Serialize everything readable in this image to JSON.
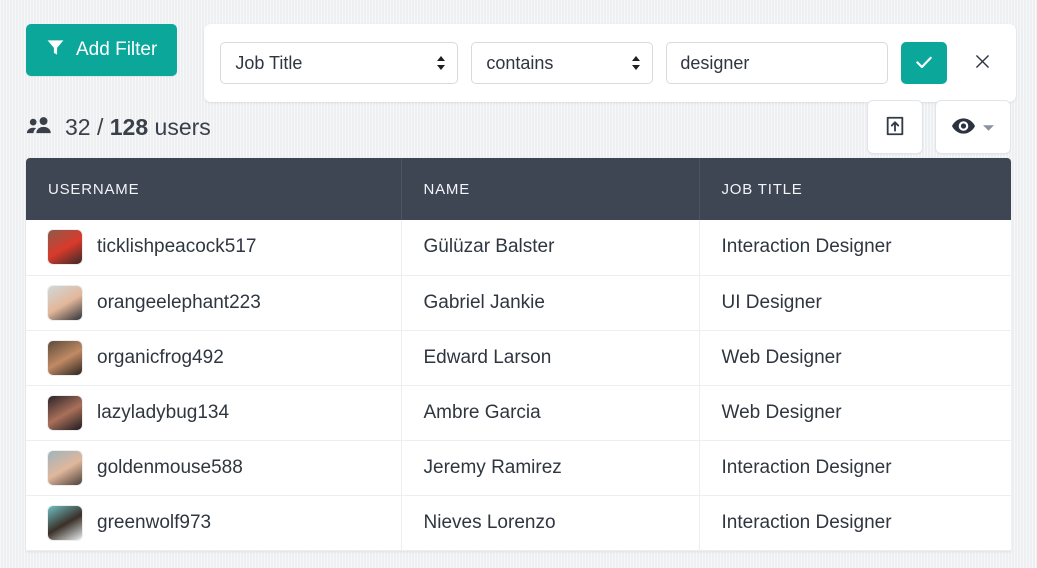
{
  "filter_bar": {
    "add_filter_label": "Add Filter",
    "add_filter_icon": "funnel-icon",
    "field_select_value": "Job Title",
    "operator_select_value": "contains",
    "value_input": "designer",
    "value_placeholder": "",
    "apply_icon": "check-icon",
    "remove_icon": "close-icon",
    "accent_color": "#0ba79b"
  },
  "summary": {
    "users_icon": "users-icon",
    "filtered_count": "32",
    "separator": "/",
    "total_count": "128",
    "unit_label": "users",
    "export_icon": "export-icon",
    "visibility_icon": "eye-icon",
    "visibility_caret_icon": "chevron-down-icon"
  },
  "table": {
    "columns": [
      "USERNAME",
      "NAME",
      "JOB TITLE"
    ],
    "header_bg": "#3e4654",
    "rows": [
      {
        "username": "ticklishpeacock517",
        "name": "Gülüzar Balster",
        "job_title": "Interaction Designer",
        "avatar_colors": [
          "#8d5a4a",
          "#d93a2b",
          "#3a2a28"
        ]
      },
      {
        "username": "orangeelephant223",
        "name": "Gabriel Jankie",
        "job_title": "UI Designer",
        "avatar_colors": [
          "#cfd8da",
          "#e3b79a",
          "#2e3338"
        ]
      },
      {
        "username": "organicfrog492",
        "name": "Edward Larson",
        "job_title": "Web Designer",
        "avatar_colors": [
          "#5c4a3a",
          "#c08a64",
          "#2b2420"
        ]
      },
      {
        "username": "lazyladybug134",
        "name": "Ambre Garcia",
        "job_title": "Web Designer",
        "avatar_colors": [
          "#2a2328",
          "#a9705a",
          "#1d1a1f"
        ]
      },
      {
        "username": "goldenmouse588",
        "name": "Jeremy Ramirez",
        "job_title": "Interaction Designer",
        "avatar_colors": [
          "#9fb4bd",
          "#e0b79c",
          "#4b4038"
        ]
      },
      {
        "username": "greenwolf973",
        "name": "Nieves Lorenzo",
        "job_title": "Interaction Designer",
        "avatar_colors": [
          "#6fc0c4",
          "#3a3028",
          "#e8eef0"
        ]
      }
    ]
  }
}
